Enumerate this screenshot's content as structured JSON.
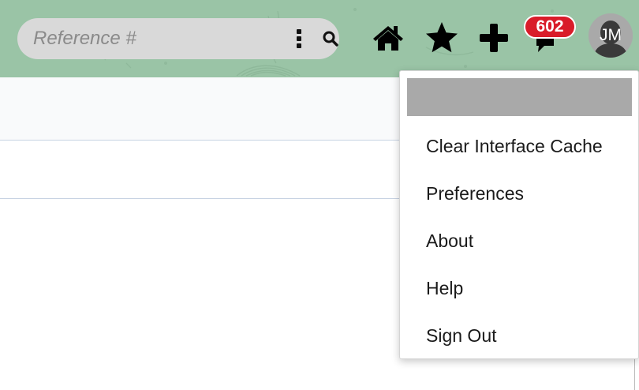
{
  "header": {
    "background_color": "#9ac4a6",
    "search": {
      "placeholder": "Reference #",
      "value": "",
      "options_icon": "kebab-vertical-icon",
      "search_icon": "magnifier-icon"
    },
    "nav_icons": [
      "home-icon",
      "star-icon",
      "plus-icon",
      "notification-icon"
    ],
    "notifications": {
      "count": "602",
      "badge_color": "#d91c2a"
    },
    "user": {
      "initials": "JM"
    }
  },
  "user_menu": {
    "header_color": "#a9a9a9",
    "items": [
      {
        "label": "Clear Interface Cache"
      },
      {
        "label": "Preferences"
      },
      {
        "label": "About"
      },
      {
        "label": "Help"
      },
      {
        "label": "Sign Out"
      }
    ]
  }
}
